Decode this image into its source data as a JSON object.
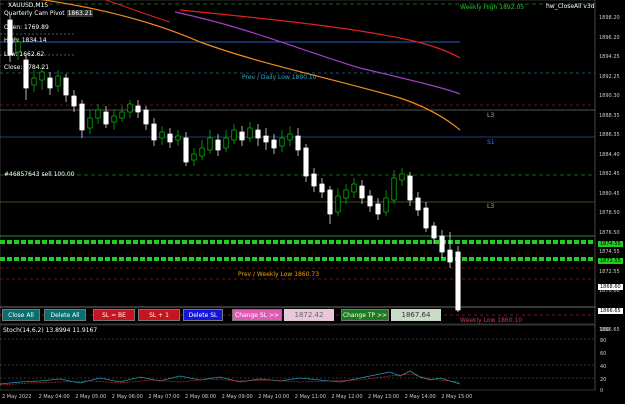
{
  "chart": {
    "symbol_label": "XAUUSD,M15",
    "expert_label": "hw_CloseAll v3d",
    "info_rows": [
      {
        "label": "Quarterly Cam Pivot",
        "value": "1863.21"
      },
      {
        "label": "Open: 1769.89",
        "value": ""
      },
      {
        "label": "High: 1834.14",
        "value": ""
      },
      {
        "label": "Low: 1662.62",
        "value": ""
      },
      {
        "label": "Close: 1784.21",
        "value": ""
      }
    ],
    "level_labels": {
      "weekly_high": "Weekly High 1892.05",
      "prev_daily_low": "Prev / Daily Low 1890.10",
      "l3_upper": "L3",
      "s1": "S1",
      "l3_lower": "L3",
      "order_label": "#46857643 sell 100.00",
      "prev_weekly_low": "Prev / Weekly Low 1860.73",
      "weekly_low": "Weekly Low 1860.10"
    },
    "price_axis": [
      "1898.20",
      "1896.20",
      "1894.25",
      "1892.25",
      "1890.30",
      "1888.35",
      "1886.35",
      "1884.40",
      "1882.45",
      "1880.45",
      "1878.50",
      "1876.50",
      "1874.55",
      "1872.55",
      "1870.60",
      "1868.60",
      "1866.65"
    ],
    "price_tags": [
      {
        "text": "1874.55",
        "color": "#22cc22"
      },
      {
        "text": "1872.55",
        "color": "#22cc22"
      },
      {
        "text": "1868.60",
        "color": "#ffffff"
      },
      {
        "text": "1866.65",
        "color": "#ffffff"
      }
    ],
    "colors": {
      "bull": "#00c800",
      "bear": "#ffffff",
      "ma_red": "#e02020",
      "ma_purple": "#a040c8",
      "ma_orange": "#f08c1e",
      "blue_line": "#3c78ff",
      "cyan_text": "#33aacc"
    }
  },
  "buttons": [
    {
      "name": "close-all-button",
      "label": "Close All",
      "bg": "#0a6e6e"
    },
    {
      "name": "delete-all-button",
      "label": "Delete All",
      "bg": "#0a6e6e"
    },
    {
      "name": "sl-be-button",
      "label": "SL = BE",
      "bg": "#c8141e"
    },
    {
      "name": "sl-plus-one-button",
      "label": "SL + 1",
      "bg": "#c8141e"
    },
    {
      "name": "delete-sl-button",
      "label": "Delete SL",
      "bg": "#1414dc"
    },
    {
      "name": "change-sl-button",
      "label": "Change SL >>",
      "bg": "#e05ab4"
    },
    {
      "name": "change-tp-button",
      "label": "Change TP >>",
      "bg": "#1e7a1e"
    }
  ],
  "inputs": {
    "sl_value": "1872.42",
    "tp_value": "1867.64"
  },
  "indicator": {
    "label": "Stoch(14,6,2) 13.8994 11.9167",
    "levels": [
      "100",
      "80",
      "60",
      "40",
      "20",
      "0"
    ]
  },
  "time_axis": [
    "2 May 2022",
    "2 May 04:00",
    "2 May 05:00",
    "2 May 06:00",
    "2 May 07:00",
    "2 May 08:00",
    "2 May 09:00",
    "2 May 10:00",
    "2 May 11:00",
    "2 May 12:00",
    "2 May 13:00",
    "2 May 14:00",
    "2 May 15:00"
  ]
}
